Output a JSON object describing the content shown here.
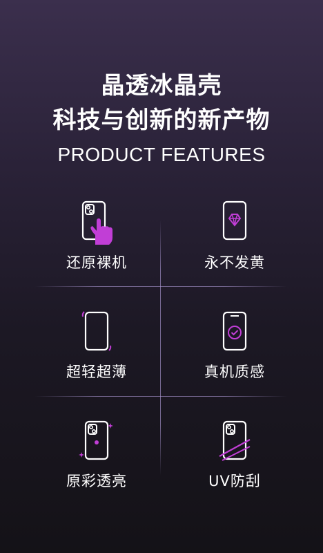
{
  "header": {
    "title_line1": "晶透冰晶壳",
    "title_line2": "科技与创新的新产物",
    "subtitle": "PRODUCT FEATURES"
  },
  "features": [
    {
      "label": "还原裸机",
      "icon": "phone-hand-icon"
    },
    {
      "label": "永不发黄",
      "icon": "phone-diamond-icon"
    },
    {
      "label": "超轻超薄",
      "icon": "phone-thin-icon"
    },
    {
      "label": "真机质感",
      "icon": "phone-check-icon"
    },
    {
      "label": "原彩透亮",
      "icon": "phone-sparkle-icon"
    },
    {
      "label": "UV防刮",
      "icon": "phone-scratch-icon"
    }
  ],
  "colors": {
    "accent": "#c13ed6",
    "line": "#ffffff"
  }
}
